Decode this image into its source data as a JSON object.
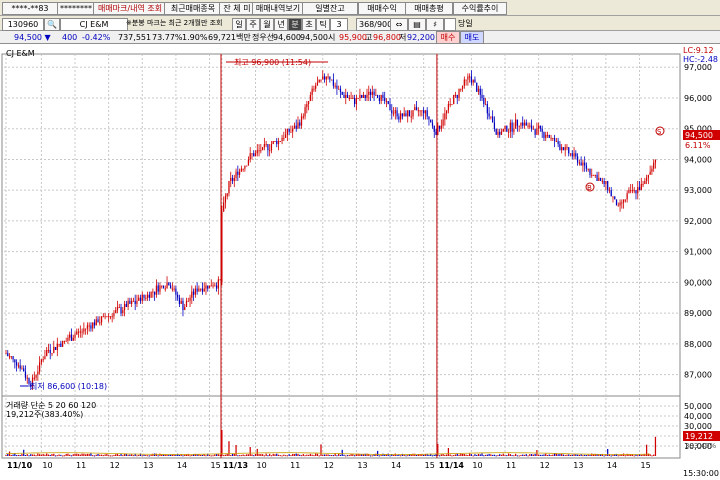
{
  "toolbar1": {
    "account": "****-**83",
    "password": "********",
    "btn_mark": "매매마크/내역 조회",
    "btn_recent": "최근매매종목",
    "btn_balance": "잔 체 미",
    "btn_history": "매매내역보기",
    "btn_daily": "일별잔고",
    "btn_profit": "매매수익",
    "btn_total": "매매총평",
    "btn_rate": "수익률추이"
  },
  "toolbar2": {
    "code": "130960",
    "name": "CJ E&M",
    "notice": "※분봉 마크는 최근 2개월만 조회",
    "period_tabs": [
      "일",
      "주",
      "월",
      "년",
      "분",
      "초",
      "틱"
    ],
    "interval": "3",
    "count": "368/900",
    "same_day": "당일"
  },
  "infobar": {
    "price": "94,500",
    "change": "400",
    "change_rate": "-0.42%",
    "volume": "737,551",
    "volume_rate": "73.77%",
    "turnover": "1.90%",
    "amount": "69,721백만",
    "prev_close_label": "정우선",
    "prev_close": "94,600",
    "open_label": "시",
    "open": "95,900",
    "low_open": "94,500",
    "high_label": "고",
    "high": "96,800",
    "low_label": "저",
    "low": "92,200",
    "buy_btn": "매수",
    "sell_btn": "매도"
  },
  "chart_labels": {
    "title": "CJ E&M",
    "high_note": "최고 96,900 (11:54)",
    "low_note": "최저 86,600 (10:18)",
    "lc": "LC:9.12",
    "hc": "HC:-2.48",
    "last_price": "94,500",
    "last_pct": "6.11%",
    "vol_title": "거래량 단순 5 20 60 120",
    "vol_value": "19,212주(383.40%)",
    "vol_last": "19,212",
    "vol_last_pct": "383.40%",
    "marker_s": "S",
    "marker_b": "B",
    "time_label": "15:30:00"
  },
  "colors": {
    "up": "#d00000",
    "down": "#0000c0",
    "grid": "#c8c8c8",
    "sep": "#c00000"
  },
  "chart_data": {
    "type": "candlestick",
    "y_ticks": [
      "97,000",
      "96,000",
      "95,000",
      "94,000",
      "93,000",
      "92,000",
      "91,000",
      "90,000",
      "89,000",
      "88,000",
      "87,000"
    ],
    "y_range": [
      86500,
      97300
    ],
    "vol_ticks": [
      "50,000",
      "40,000",
      "30,000",
      "20,000",
      "10,000"
    ],
    "vol_range": [
      0,
      52000
    ],
    "x_ticks": [
      {
        "i": 0,
        "label": "11/10"
      },
      {
        "i": 20,
        "label": "10"
      },
      {
        "i": 39,
        "label": "11"
      },
      {
        "i": 58,
        "label": "12"
      },
      {
        "i": 77,
        "label": "13"
      },
      {
        "i": 96,
        "label": "14"
      },
      {
        "i": 115,
        "label": "15"
      },
      {
        "i": 122,
        "label": "11/13"
      },
      {
        "i": 141,
        "label": "10"
      },
      {
        "i": 160,
        "label": "11"
      },
      {
        "i": 179,
        "label": "12"
      },
      {
        "i": 198,
        "label": "13"
      },
      {
        "i": 217,
        "label": "14"
      },
      {
        "i": 236,
        "label": "15"
      },
      {
        "i": 244,
        "label": "11/14"
      },
      {
        "i": 263,
        "label": "10"
      },
      {
        "i": 282,
        "label": "11"
      },
      {
        "i": 301,
        "label": "12"
      },
      {
        "i": 320,
        "label": "13"
      },
      {
        "i": 339,
        "label": "14"
      },
      {
        "i": 358,
        "label": "15"
      }
    ],
    "session_breaks": [
      122,
      244
    ],
    "n_candles": 368,
    "close_keyframes": [
      [
        0,
        87700
      ],
      [
        8,
        87300
      ],
      [
        14,
        86700
      ],
      [
        22,
        87700
      ],
      [
        36,
        88200
      ],
      [
        50,
        88700
      ],
      [
        64,
        89100
      ],
      [
        80,
        89600
      ],
      [
        92,
        90000
      ],
      [
        100,
        89200
      ],
      [
        108,
        89800
      ],
      [
        121,
        90000
      ],
      [
        122,
        92300
      ],
      [
        126,
        93200
      ],
      [
        138,
        94100
      ],
      [
        154,
        94600
      ],
      [
        166,
        95200
      ],
      [
        174,
        96300
      ],
      [
        182,
        96800
      ],
      [
        188,
        96200
      ],
      [
        196,
        95900
      ],
      [
        208,
        96200
      ],
      [
        222,
        95400
      ],
      [
        236,
        95600
      ],
      [
        243,
        94900
      ],
      [
        244,
        95000
      ],
      [
        252,
        95900
      ],
      [
        262,
        96700
      ],
      [
        270,
        95900
      ],
      [
        278,
        94800
      ],
      [
        290,
        95200
      ],
      [
        306,
        94800
      ],
      [
        318,
        94200
      ],
      [
        330,
        93600
      ],
      [
        340,
        93100
      ],
      [
        346,
        92400
      ],
      [
        352,
        92900
      ],
      [
        360,
        93100
      ],
      [
        368,
        94200
      ],
      [
        374,
        94600
      ],
      [
        380,
        94900
      ]
    ],
    "volume_base": 1400,
    "volume_spikes": [
      [
        2,
        4500
      ],
      [
        10,
        6200
      ],
      [
        122,
        26000
      ],
      [
        126,
        14800
      ],
      [
        130,
        11000
      ],
      [
        138,
        9000
      ],
      [
        142,
        7100
      ],
      [
        178,
        11600
      ],
      [
        190,
        6200
      ],
      [
        210,
        5100
      ],
      [
        244,
        12000
      ],
      [
        250,
        8000
      ],
      [
        300,
        6000
      ],
      [
        340,
        7000
      ],
      [
        362,
        11300
      ],
      [
        367,
        19212
      ]
    ]
  }
}
